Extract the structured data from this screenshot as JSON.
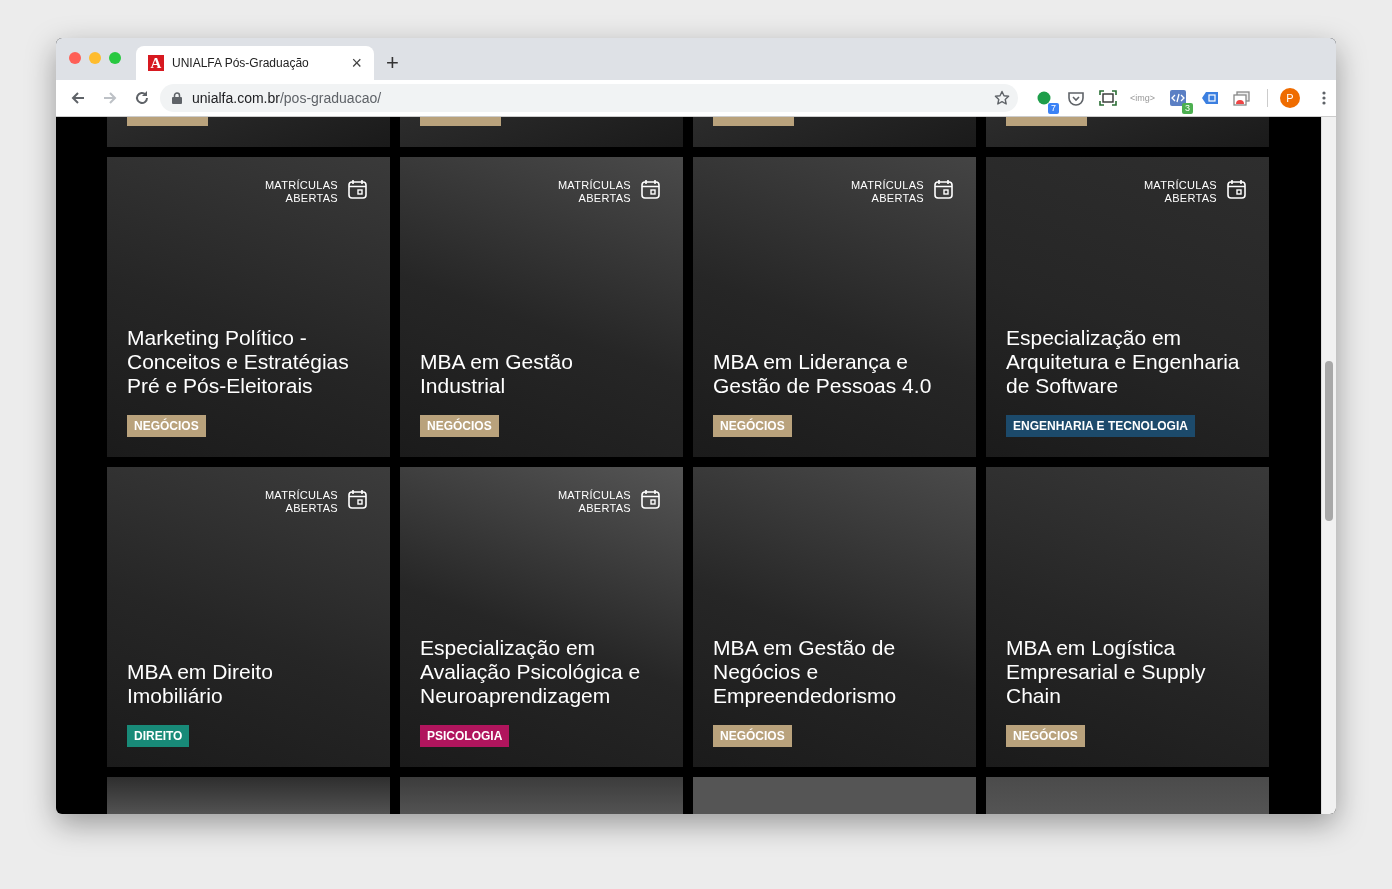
{
  "browser": {
    "tab": {
      "title": "UNIALFA Pós-Graduação",
      "favicon": "A",
      "close": "×"
    },
    "new_tab": "+",
    "url": {
      "host": "unialfa.com.br",
      "path": "/pos-graduacao/"
    },
    "extensions": [
      {
        "kind": "dot",
        "badge": "7"
      },
      {
        "kind": "pocket"
      },
      {
        "kind": "capture"
      },
      {
        "kind": "text",
        "label": "<img>"
      },
      {
        "kind": "code",
        "badge": "3"
      },
      {
        "kind": "tagger"
      },
      {
        "kind": "cast"
      }
    ],
    "avatar": "P"
  },
  "partial_top": [
    {
      "color": "#b9a27c"
    },
    {
      "color": "#b9a27c"
    },
    {
      "color": "#b9a27c"
    },
    {
      "color": "#b9a27c"
    }
  ],
  "courses": [
    {
      "status": "MATRÍCULAS ABERTAS",
      "title": "Marketing Político - Conceitos e Estratégias Pré e Pós-Eleitorais",
      "tag": "NEGÓCIOS",
      "color": "#b9a27c"
    },
    {
      "status": "MATRÍCULAS ABERTAS",
      "title": "MBA em Gestão Industrial",
      "tag": "NEGÓCIOS",
      "color": "#b9a27c"
    },
    {
      "status": "MATRÍCULAS ABERTAS",
      "title": "MBA em Liderança e Gestão de Pessoas 4.0",
      "tag": "NEGÓCIOS",
      "color": "#b9a27c"
    },
    {
      "status": "MATRÍCULAS ABERTAS",
      "title": "Especialização em Arquitetura e Engenharia de Software",
      "tag": "ENGENHARIA E TECNOLOGIA",
      "color": "#1c4a6b"
    },
    {
      "status": "MATRÍCULAS ABERTAS",
      "title": "MBA em Direito Imobiliário",
      "tag": "DIREITO",
      "color": "#188a78"
    },
    {
      "status": "MATRÍCULAS ABERTAS",
      "title": "Especialização em Avaliação Psicológica e Neuroaprendizagem",
      "tag": "PSICOLOGIA",
      "color": "#b0155d"
    },
    {
      "title": "MBA em Gestão de Negócios e Empreendedorismo",
      "tag": "NEGÓCIOS",
      "color": "#b9a27c"
    },
    {
      "title": "MBA em Logística Empresarial e Supply Chain",
      "tag": "NEGÓCIOS",
      "color": "#b9a27c"
    }
  ]
}
